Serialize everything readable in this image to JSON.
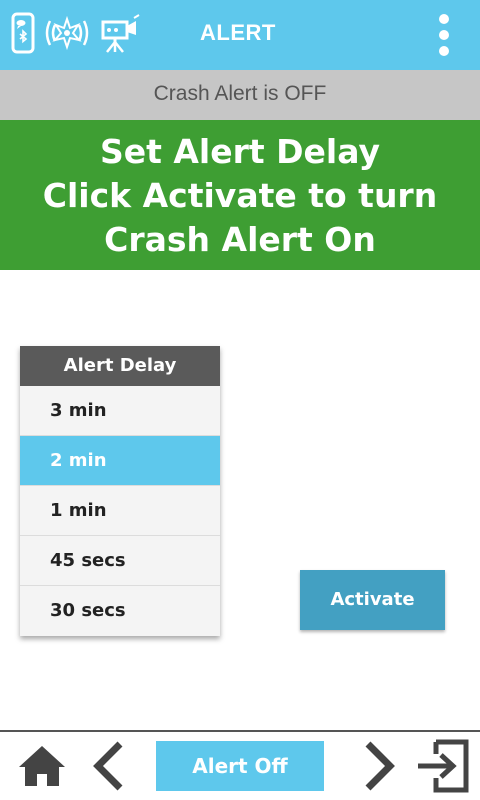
{
  "header": {
    "title": "ALERT",
    "icons": [
      "phone-bluetooth-icon",
      "crash-signal-icon",
      "camera-icon"
    ],
    "menu_icon": "more-vertical-icon",
    "background_color": "#5ec8ec"
  },
  "status": {
    "text": "Crash Alert is OFF"
  },
  "banner": {
    "lines": [
      "Set Alert Delay",
      "Click Activate to turn",
      "Crash Alert On"
    ],
    "background_color": "#3e9e33"
  },
  "delay_picker": {
    "header": "Alert Delay",
    "options": [
      "3 min",
      "2 min",
      "1 min",
      "45 secs",
      "30 secs"
    ],
    "selected": "2 min"
  },
  "actions": {
    "activate_label": "Activate"
  },
  "bottom_nav": {
    "alert_off_label": "Alert Off",
    "icons": [
      "home-icon",
      "chevron-left-icon",
      "chevron-right-icon",
      "exit-icon"
    ]
  }
}
